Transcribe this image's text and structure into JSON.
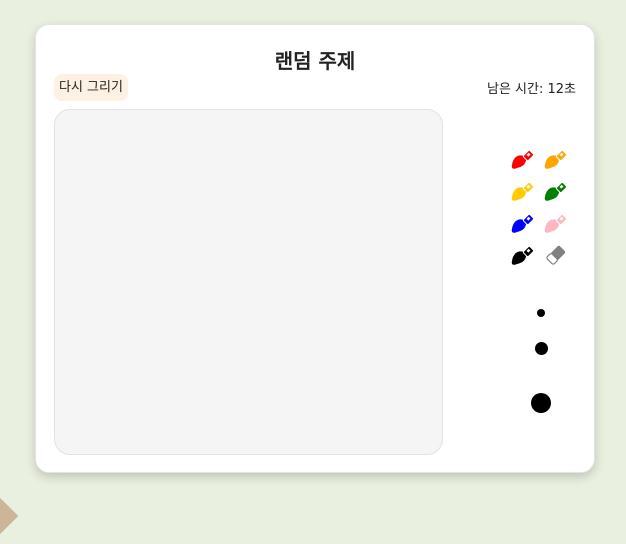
{
  "header": {
    "title": "랜덤 주제",
    "redraw_label": "다시 그리기",
    "timer_text": "남은 시간: 12초"
  },
  "palette": [
    {
      "name": "red",
      "color": "#ff0000",
      "icon": "brush-icon"
    },
    {
      "name": "orange",
      "color": "#ffa500",
      "icon": "brush-icon"
    },
    {
      "name": "yellow",
      "color": "#ffcc00",
      "icon": "brush-icon"
    },
    {
      "name": "green",
      "color": "#008000",
      "icon": "brush-icon"
    },
    {
      "name": "blue",
      "color": "#0000ff",
      "icon": "brush-icon"
    },
    {
      "name": "pink",
      "color": "#ffb6c1",
      "icon": "brush-icon"
    },
    {
      "name": "black",
      "color": "#000000",
      "icon": "brush-icon"
    },
    {
      "name": "eraser",
      "color": "#808080",
      "icon": "eraser-icon"
    }
  ],
  "brush_sizes": [
    "small",
    "medium",
    "large"
  ],
  "colors": {
    "background": "#eaf0df",
    "card": "#ffffff",
    "canvas": "#f5f5f5",
    "button": "#fdf1e3"
  }
}
